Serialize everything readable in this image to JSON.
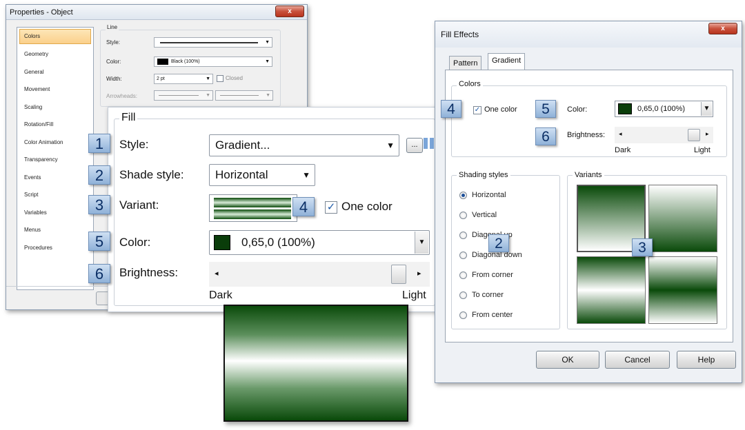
{
  "properties": {
    "title": "Properties - Object",
    "close": "x",
    "categories": [
      "Colors",
      "Geometry",
      "General",
      "Movement",
      "Scaling",
      "Rotation/Fill",
      "Color Animation",
      "Transparency",
      "Events",
      "Script",
      "Variables",
      "Menus",
      "Procedures"
    ],
    "line": {
      "group": "Line",
      "style_label": "Style:",
      "color_label": "Color:",
      "color_value": "Black (100%)",
      "width_label": "Width:",
      "width_value": "2 pt",
      "closed_label": "Closed",
      "arrowheads_label": "Arrowheads:"
    }
  },
  "fill": {
    "group": "Fill",
    "style_label": "Style:",
    "style_value": "Gradient...",
    "ellipsis": "...",
    "shade_label": "Shade style:",
    "shade_value": "Horizontal",
    "variant_label": "Variant:",
    "one_color_label": "One color",
    "color_label": "Color:",
    "color_value": "0,65,0 (100%)",
    "brightness_label": "Brightness:",
    "dark": "Dark",
    "light": "Light",
    "swatch_color": "#0a3d0a"
  },
  "fill_effects": {
    "title": "Fill Effects",
    "close": "x",
    "tabs": [
      "Pattern",
      "Gradient"
    ],
    "colors_group": "Colors",
    "one_color": "One color",
    "color_label": "Color:",
    "color_value": "0,65,0 (100%)",
    "brightness_label": "Brightness:",
    "dark": "Dark",
    "light": "Light",
    "shading_group": "Shading styles",
    "shading_options": [
      "Horizontal",
      "Vertical",
      "Diagonal up",
      "Diagonal down",
      "From corner",
      "To corner",
      "From center"
    ],
    "variants_group": "Variants",
    "buttons": {
      "ok": "OK",
      "cancel": "Cancel",
      "help": "Help"
    }
  },
  "badges": {
    "b1": "1",
    "b2": "2",
    "b3": "3",
    "b4": "4",
    "b5": "5",
    "b6": "6"
  },
  "colors": {
    "dark_green": "#0a3d0a",
    "accent_blue": "#6a9ad3"
  }
}
